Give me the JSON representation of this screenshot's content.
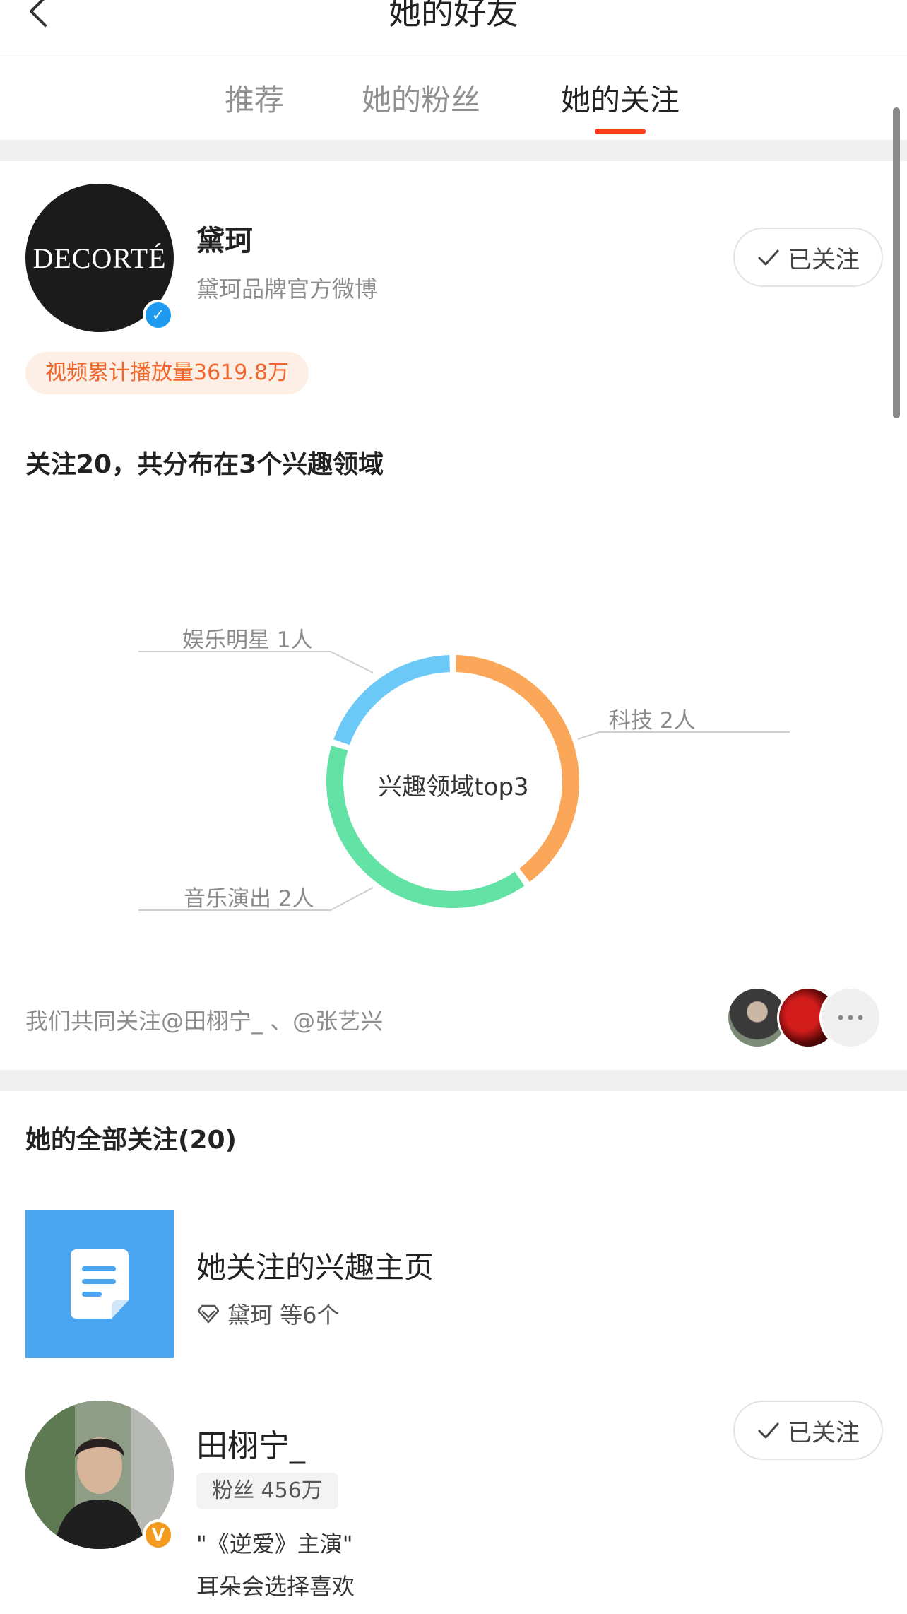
{
  "header": {
    "title": "她的好友"
  },
  "tabs": [
    {
      "label": "推荐"
    },
    {
      "label": "她的粉丝"
    },
    {
      "label": "她的关注"
    }
  ],
  "active_tab": "她的关注",
  "profile": {
    "logo_text": "DECORTÉ",
    "name": "黛珂",
    "description": "黛珂品牌官方微博",
    "follow_label": "已关注",
    "video_plays": "视频累计播放量3619.8万"
  },
  "interest": {
    "heading": "关注20，共分布在3个兴趣领域",
    "center_label": "兴趣领域top3"
  },
  "chart_data": {
    "type": "pie",
    "categories": [
      "娱乐明星 1人",
      "科技 2人",
      "音乐演出 2人"
    ],
    "values": [
      1,
      2,
      2
    ],
    "colors": [
      "#6cc8f7",
      "#fba75a",
      "#63e2a6"
    ],
    "center_text": "兴趣领域top3",
    "legend": "none"
  },
  "mutual": {
    "text": "我们共同关注@田栩宁_ 、@张艺兴"
  },
  "all_follows": {
    "heading": "她的全部关注(20)",
    "interest_page": {
      "title": "她关注的兴趣主页",
      "sub": "黛珂 等6个"
    },
    "first_user": {
      "name": "田栩宁_",
      "fans": "粉丝 456万",
      "bio1": "\"《逆爱》主演\"",
      "bio2": "耳朵会选择喜欢",
      "follow_label": "已关注"
    }
  },
  "colors": {
    "accent": "#ff3a1f",
    "verified_blue": "#1e9bf0",
    "verified_orange": "#f29b1e",
    "pill_text": "#f0662a"
  }
}
